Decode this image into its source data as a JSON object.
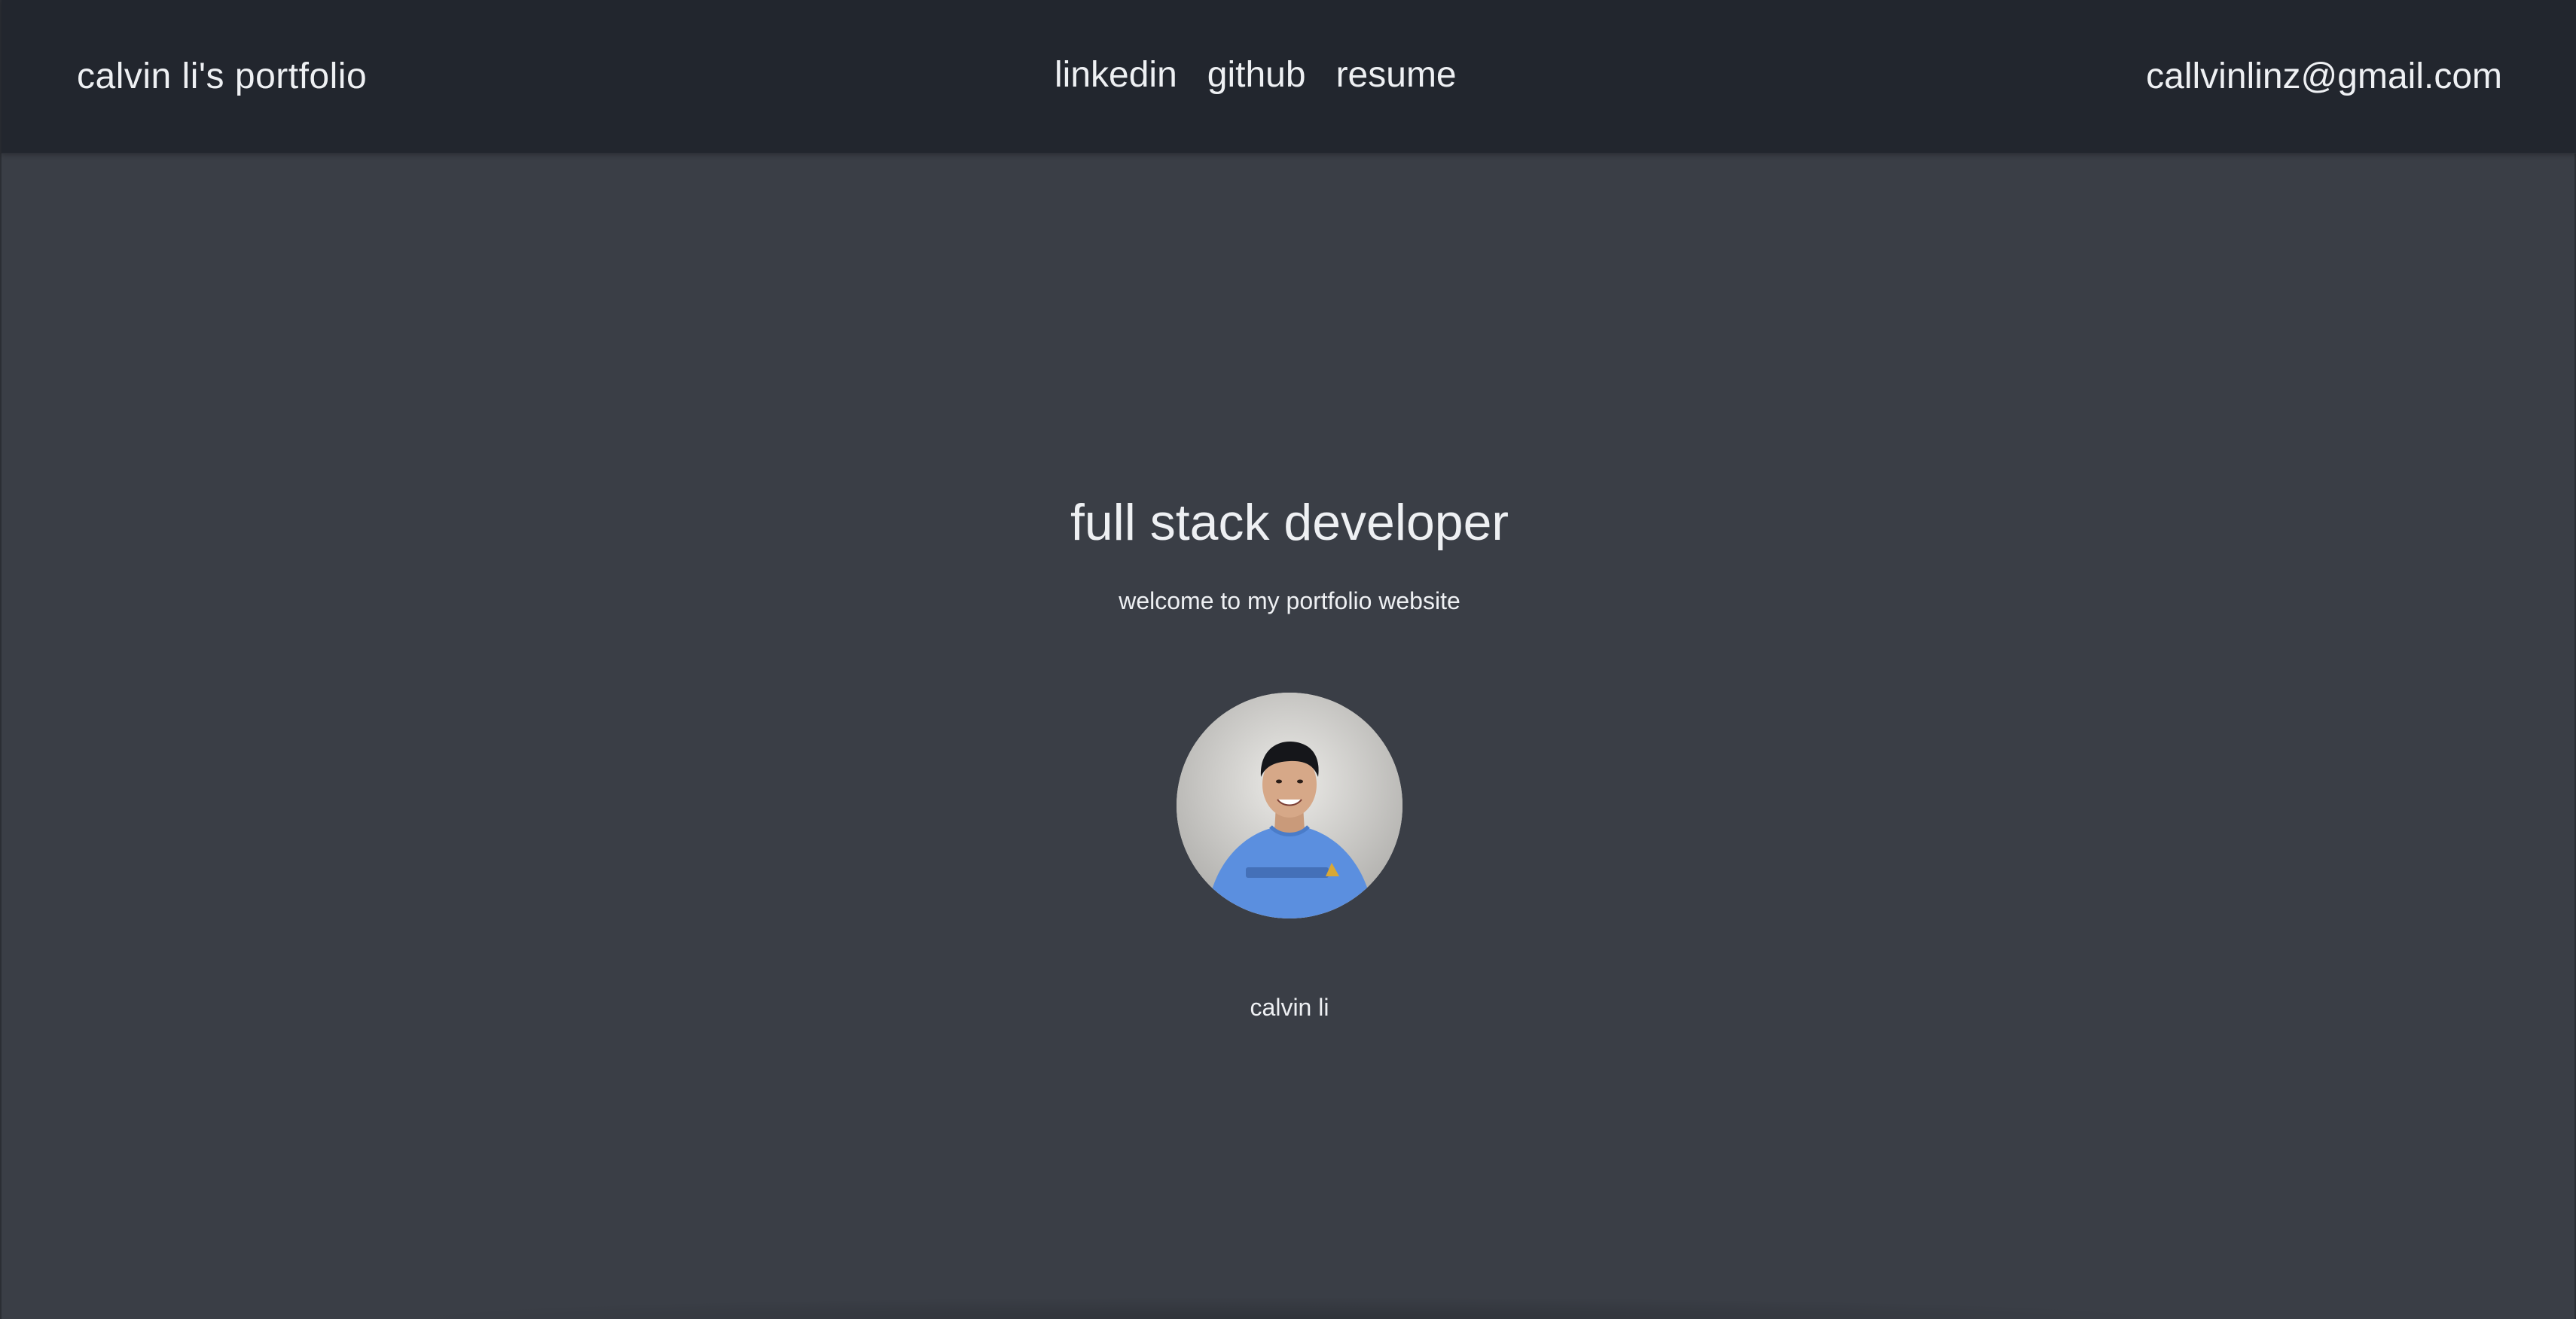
{
  "navbar": {
    "brand": "calvin li's portfolio",
    "links": [
      {
        "label": "linkedin"
      },
      {
        "label": "github"
      },
      {
        "label": "resume"
      }
    ],
    "email": "callvinlinz@gmail.com"
  },
  "hero": {
    "headline": "full stack developer",
    "subtitle": "welcome to my portfolio website",
    "avatar_icon": "profile-photo",
    "name": "calvin li"
  },
  "colors": {
    "navbar_bg": "#22262e",
    "page_bg": "#3a3e46",
    "text": "#eef0f3"
  }
}
